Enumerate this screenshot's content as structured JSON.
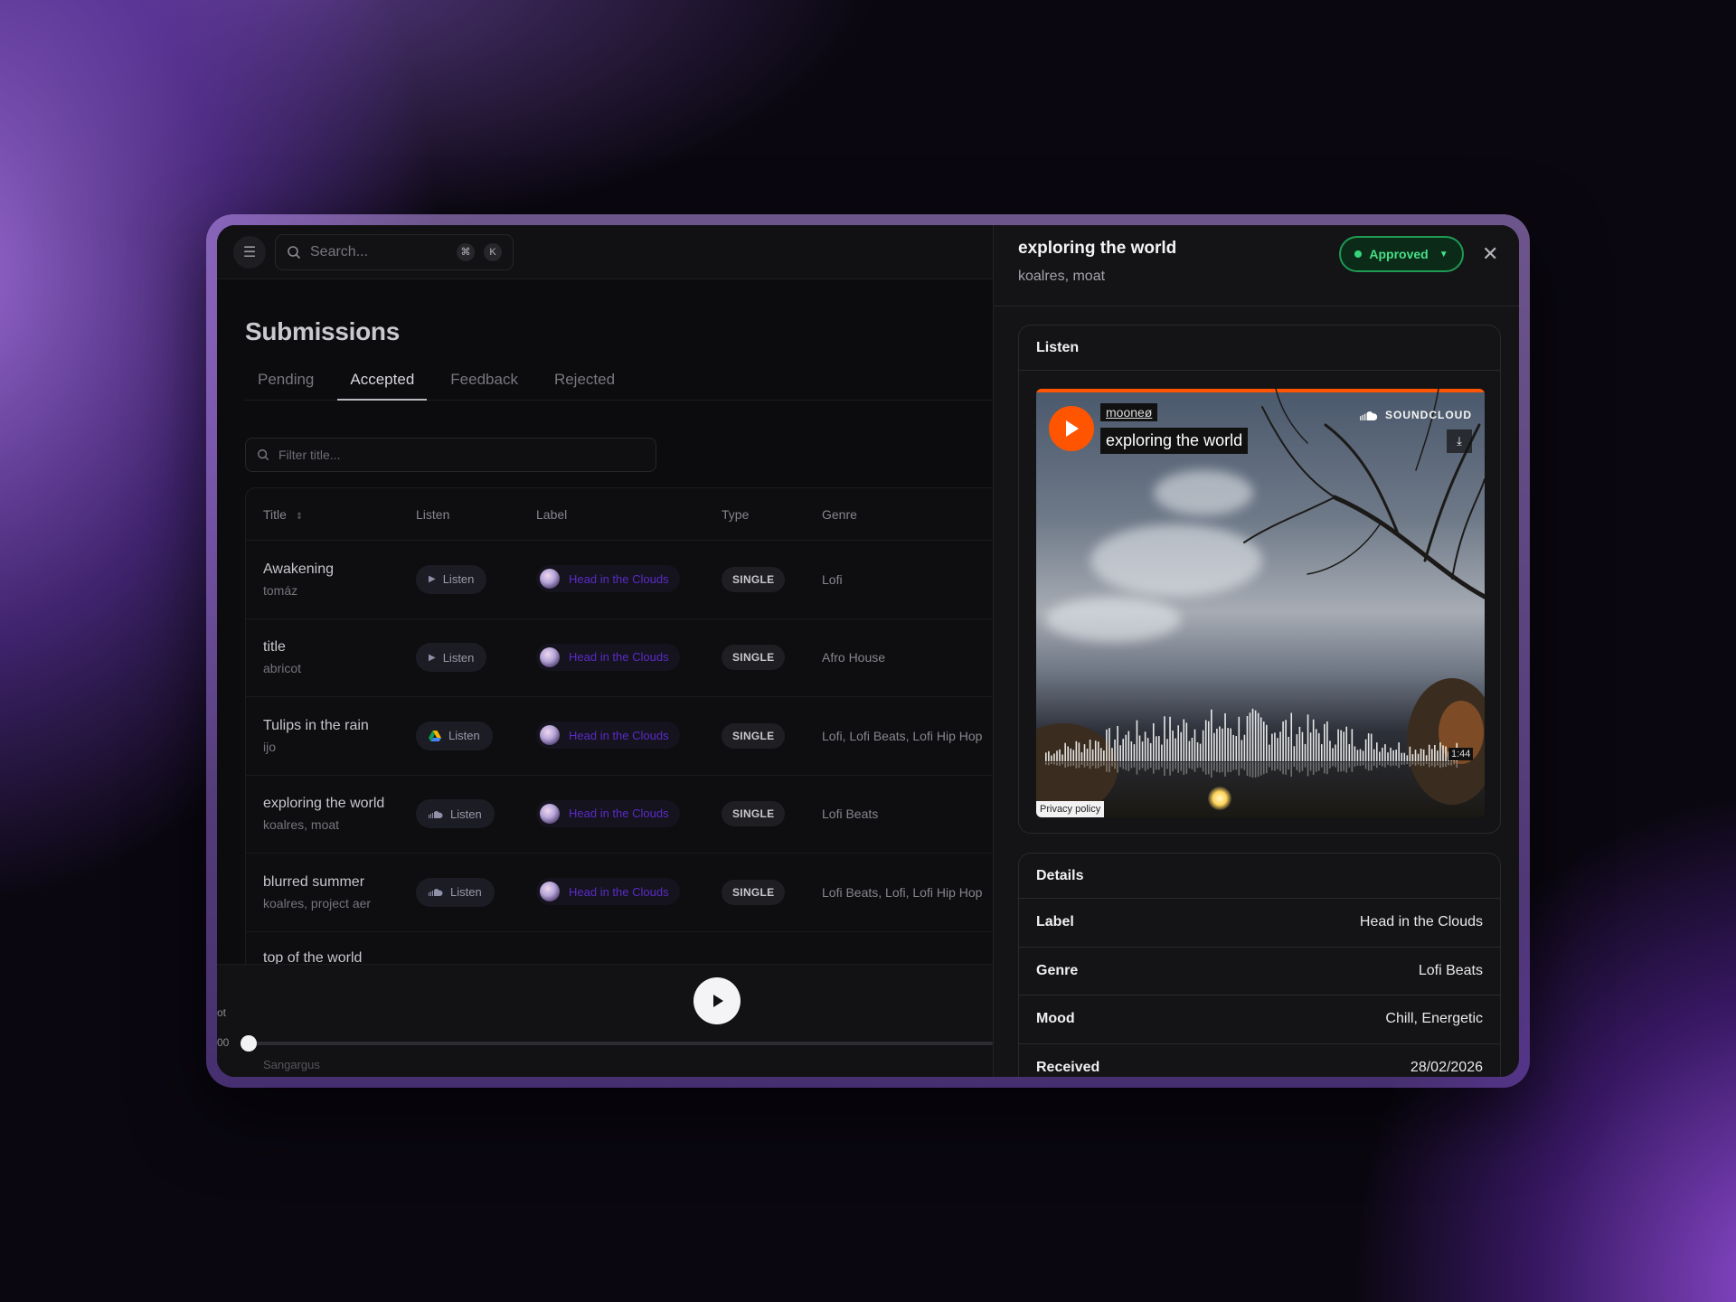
{
  "search": {
    "placeholder": "Search...",
    "kbd": [
      "⌘",
      "K"
    ]
  },
  "page": {
    "title": "Submissions"
  },
  "tabs": [
    {
      "label": "Pending"
    },
    {
      "label": "Accepted"
    },
    {
      "label": "Feedback"
    },
    {
      "label": "Rejected"
    }
  ],
  "filter": {
    "placeholder": "Filter title..."
  },
  "table": {
    "headers": {
      "title": "Title",
      "listen": "Listen",
      "label": "Label",
      "type": "Type",
      "genre": "Genre"
    },
    "rows": [
      {
        "title": "Awakening",
        "artist": "tomáz",
        "listen": "Listen",
        "source_icon": "play-icon",
        "label": "Head in the Clouds",
        "type": "SINGLE",
        "genre": "Lofi"
      },
      {
        "title": "title",
        "artist": "abricot",
        "listen": "Listen",
        "source_icon": "play-icon",
        "label": "Head in the Clouds",
        "type": "SINGLE",
        "genre": "Afro House"
      },
      {
        "title": "Tulips in the rain",
        "artist": "ijo",
        "listen": "Listen",
        "source_icon": "google-drive-icon",
        "label": "Head in the Clouds",
        "type": "SINGLE",
        "genre": "Lofi, Lofi Beats, Lofi Hip Hop"
      },
      {
        "title": "exploring the world",
        "artist": "koalres, moat",
        "listen": "Listen",
        "source_icon": "soundcloud-icon",
        "label": "Head in the Clouds",
        "type": "SINGLE",
        "genre": "Lofi Beats"
      },
      {
        "title": "blurred summer",
        "artist": "koalres, project aer",
        "listen": "Listen",
        "source_icon": "soundcloud-icon",
        "label": "Head in the Clouds",
        "type": "SINGLE",
        "genre": "Lofi Beats, Lofi, Lofi Hip Hop"
      },
      {
        "title": "top of the world",
        "artist": "",
        "listen": "",
        "label": "",
        "type": "",
        "genre": ""
      }
    ]
  },
  "player": {
    "left_text_a": "ot",
    "left_text_b": "00",
    "peek_text": "Sangargus",
    "progress": 0
  },
  "panel": {
    "title": "exploring the world",
    "artists": "koalres, moat",
    "status": "Approved",
    "status_color": "#35d67a",
    "listen_card": {
      "heading": "Listen",
      "embed": {
        "user": "mooneø",
        "track": "exploring the world",
        "brand": "SOUNDCLOUD",
        "duration": "1:44",
        "privacy": "Privacy policy",
        "accent": "#ff5500"
      }
    },
    "details_card": {
      "heading": "Details",
      "rows": [
        {
          "key": "Label",
          "value": "Head in the Clouds"
        },
        {
          "key": "Genre",
          "value": "Lofi Beats"
        },
        {
          "key": "Mood",
          "value": "Chill, Energetic"
        },
        {
          "key": "Received",
          "value": "28/02/2026"
        }
      ]
    }
  }
}
